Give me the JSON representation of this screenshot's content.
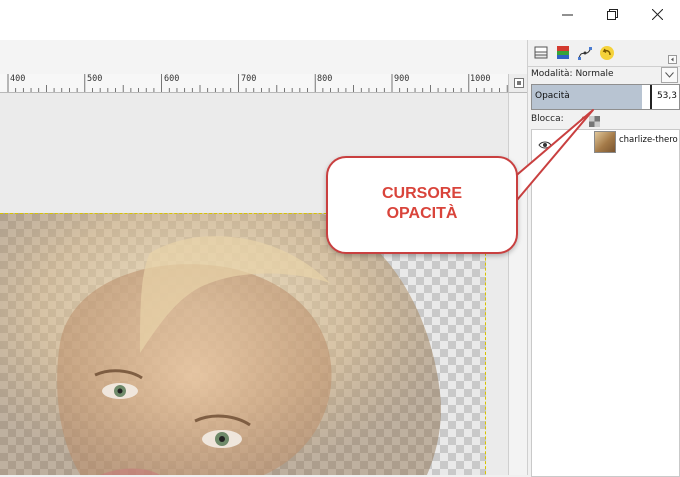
{
  "window": {
    "minimize_glyph": "─",
    "maximize_glyph": "▢",
    "close_glyph": "✕"
  },
  "ruler": {
    "ticks": [
      "400",
      "500",
      "600",
      "700",
      "800",
      "900",
      "1000"
    ]
  },
  "dock": {
    "tabs": [
      "layers-icon",
      "channels-icon",
      "paths-icon",
      "undo-history-icon"
    ],
    "mode_label": "Modalità: Normale",
    "opacity_label": "Opacità",
    "opacity_value": "53,3",
    "opacity_fraction": 0.533,
    "lock_label": "Blocca:",
    "layers": [
      {
        "name": "charlize-thero",
        "visible": true
      }
    ]
  },
  "callout": {
    "line1": "CURSORE",
    "line2": "OPACITÀ",
    "color": "#d9443b"
  },
  "colors": {
    "accent": "#c94040",
    "selection_border": "#d8c400"
  }
}
